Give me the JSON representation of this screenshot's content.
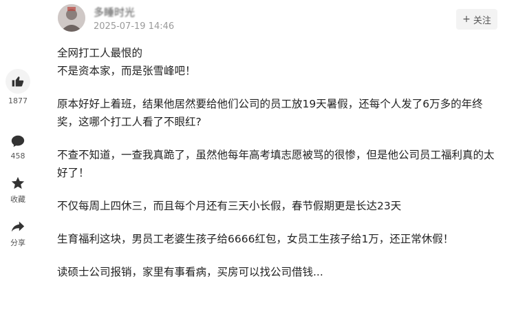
{
  "header": {
    "author_name": "多睡时光",
    "date": "2025-07-19 14:46",
    "follow_plus": "+",
    "follow_label": "关注"
  },
  "sidebar": {
    "like_count": "1877",
    "comment_count": "458",
    "favorite_label": "收藏",
    "share_label": "分享"
  },
  "article": {
    "line1": "全网打工人最恨的",
    "line2": "不是资本家，而是张雪峰吧！",
    "para2": "原本好好上着班，结果他居然要给他们公司的员工放19天暑假，还每个人发了6万多的年终奖，这哪个打工人看了不眼红?",
    "para3": "不查不知道，一查我真跪了，虽然他每年高考填志愿被骂的很惨，但是他公司员工福利真的太好了！",
    "para4": "不仅每周上四休三，而且每个月还有三天小长假，春节假期更是长达23天",
    "para5": "生育福利这块，男员工老婆生孩子给6666红包，女员工生孩子给1万，还正常休假！",
    "para6": "读硕士公司报销，家里有事看病，买房可以找公司借钱..."
  }
}
